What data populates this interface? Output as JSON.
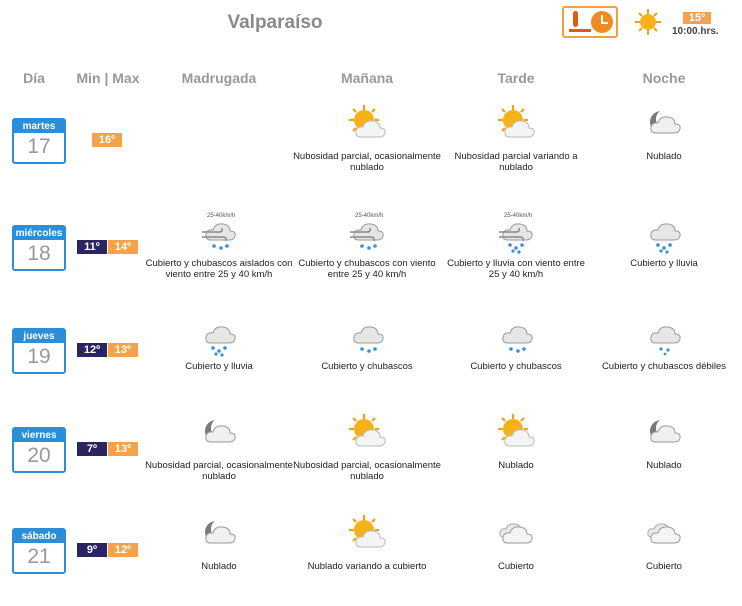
{
  "city": "Valparaíso",
  "current": {
    "temp": "15º",
    "time": "10:00.hrs.",
    "icon": "sun-icon"
  },
  "headers": {
    "dia": "Día",
    "minmax": "Min | Max",
    "madrugada": "Madrugada",
    "manana": "Mañana",
    "tarde": "Tarde",
    "noche": "Noche"
  },
  "days": [
    {
      "weekday": "martes",
      "date": "17",
      "min": "",
      "max": "16º",
      "periods": [
        {
          "icon": "",
          "desc": ""
        },
        {
          "icon": "sun-cloud-icon",
          "desc": "Nubosidad parcial, ocasionalmente nublado"
        },
        {
          "icon": "sun-cloud-icon",
          "desc": "Nubosidad parcial variando a nublado"
        },
        {
          "icon": "moon-cloud-icon",
          "desc": "Nublado"
        }
      ]
    },
    {
      "weekday": "miércoles",
      "date": "18",
      "min": "11º",
      "max": "14º",
      "periods": [
        {
          "icon": "wind-showers-icon",
          "wind": "25-40km/h",
          "desc": "Cubierto y chubascos aislados con viento entre 25 y 40 km/h"
        },
        {
          "icon": "wind-showers-icon",
          "wind": "25-40km/h",
          "desc": "Cubierto y chubascos con viento entre 25 y 40 km/h"
        },
        {
          "icon": "wind-rain-icon",
          "wind": "25-40km/h",
          "desc": "Cubierto y lluvia con viento entre 25 y 40 km/h"
        },
        {
          "icon": "rain-cloud-icon",
          "desc": "Cubierto y lluvia"
        }
      ]
    },
    {
      "weekday": "jueves",
      "date": "19",
      "min": "12º",
      "max": "13º",
      "periods": [
        {
          "icon": "rain-cloud-icon",
          "desc": "Cubierto y lluvia"
        },
        {
          "icon": "showers-cloud-icon",
          "desc": "Cubierto y chubascos"
        },
        {
          "icon": "showers-cloud-icon",
          "desc": "Cubierto y chubascos"
        },
        {
          "icon": "light-showers-icon",
          "desc": "Cubierto y chubascos débiles"
        }
      ]
    },
    {
      "weekday": "viernes",
      "date": "20",
      "min": "7º",
      "max": "13º",
      "periods": [
        {
          "icon": "moon-cloud-icon",
          "desc": "Nubosidad parcial, ocasionalmente nublado"
        },
        {
          "icon": "sun-cloud-icon",
          "desc": "Nubosidad parcial, ocasionalmente nublado"
        },
        {
          "icon": "sun-cloud-icon",
          "desc": "Nublado"
        },
        {
          "icon": "moon-cloud-icon",
          "desc": "Nublado"
        }
      ]
    },
    {
      "weekday": "sábado",
      "date": "21",
      "min": "9º",
      "max": "12º",
      "periods": [
        {
          "icon": "moon-cloud-icon",
          "desc": "Nublado"
        },
        {
          "icon": "sun-cloud-icon",
          "desc": "Nublado variando a cubierto"
        },
        {
          "icon": "overcast-icon",
          "desc": "Cubierto"
        },
        {
          "icon": "overcast-icon",
          "desc": "Cubierto"
        }
      ]
    }
  ]
}
